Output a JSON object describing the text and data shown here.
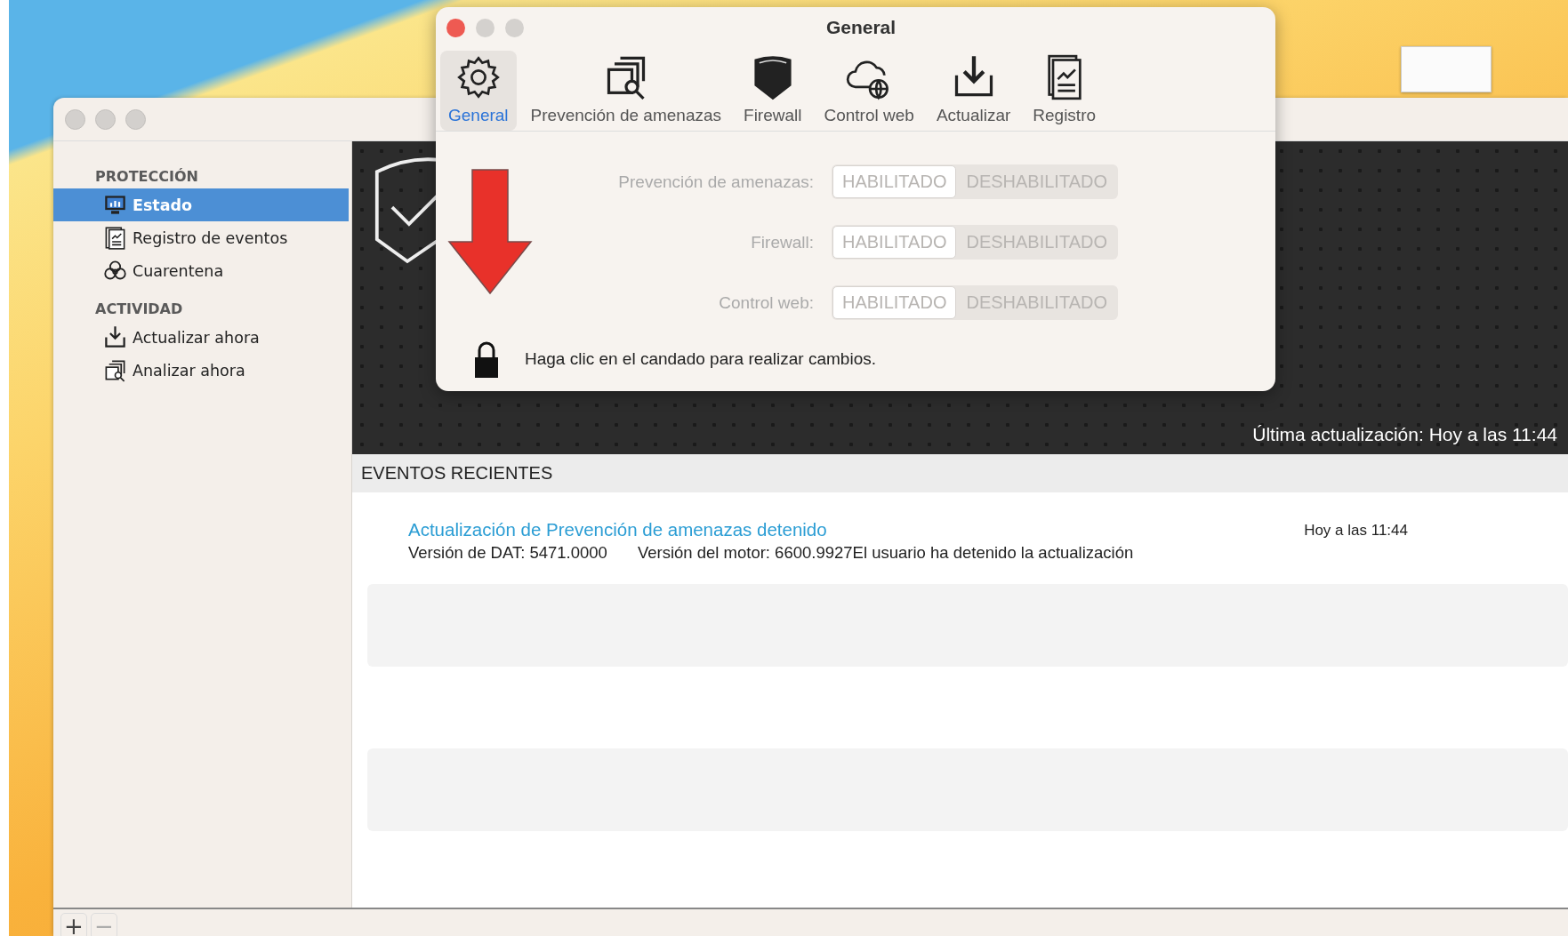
{
  "main_window": {
    "sidebar": {
      "sections": [
        {
          "heading": "PROTECCIÓN",
          "items": [
            {
              "label": "Estado",
              "selected": true
            },
            {
              "label": "Registro de eventos",
              "selected": false
            },
            {
              "label": "Cuarentena",
              "selected": false
            }
          ]
        },
        {
          "heading": "ACTIVIDAD",
          "items": [
            {
              "label": "Actualizar ahora",
              "selected": false
            },
            {
              "label": "Analizar ahora",
              "selected": false
            }
          ]
        }
      ]
    },
    "banner": {
      "last_update": "Última actualización: Hoy a las 11:44"
    },
    "recent_events": {
      "heading": "EVENTOS RECIENTES",
      "events": [
        {
          "title": "Actualización de Prevención de amenazas detenido",
          "dat_version": "Versión de DAT: 5471.0000",
          "details": "Versión del motor: 6600.9927El usuario ha detenido la actualización",
          "time": "Hoy a las 11:44"
        }
      ]
    },
    "bottom_bar": {
      "buttons": [
        "+",
        "−"
      ]
    }
  },
  "preferences_window": {
    "title": "General",
    "tabs": [
      {
        "label": "General",
        "selected": true
      },
      {
        "label": "Prevención de amenazas",
        "selected": false
      },
      {
        "label": "Firewall",
        "selected": false
      },
      {
        "label": "Control web",
        "selected": false
      },
      {
        "label": "Actualizar",
        "selected": false
      },
      {
        "label": "Registro",
        "selected": false
      }
    ],
    "settings": [
      {
        "label": "Prevención de amenazas:",
        "disabled": true,
        "options": [
          {
            "label": "HABILITADO",
            "selected": true
          },
          {
            "label": "DESHABILITADO",
            "selected": false
          }
        ]
      },
      {
        "label": "Firewall:",
        "disabled": true,
        "options": [
          {
            "label": "HABILITADO",
            "selected": true
          },
          {
            "label": "DESHABILITADO",
            "selected": false
          }
        ]
      },
      {
        "label": "Control web:",
        "disabled": true,
        "options": [
          {
            "label": "HABILITADO",
            "selected": true
          },
          {
            "label": "DESHABILITADO",
            "selected": false
          }
        ]
      }
    ],
    "lock": {
      "locked": true,
      "hint": "Haga clic en el candado para realizar cambios."
    }
  }
}
